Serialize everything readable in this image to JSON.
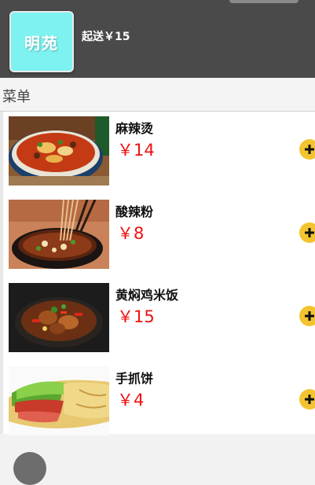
{
  "shop": {
    "logo_text": "明苑",
    "min_order": "起送￥15"
  },
  "section": {
    "title": "菜单"
  },
  "menu": [
    {
      "name": "麻辣烫",
      "price": "￥14"
    },
    {
      "name": "酸辣粉",
      "price": "￥8"
    },
    {
      "name": "黄焖鸡米饭",
      "price": "￥15"
    },
    {
      "name": "手抓饼",
      "price": "￥4"
    }
  ],
  "colors": {
    "header_bg": "#4a4a4a",
    "logo_bg": "#7df2f0",
    "price": "#ee1111",
    "add_button": "#f4c430"
  },
  "icons": {
    "add": "plus-icon"
  }
}
